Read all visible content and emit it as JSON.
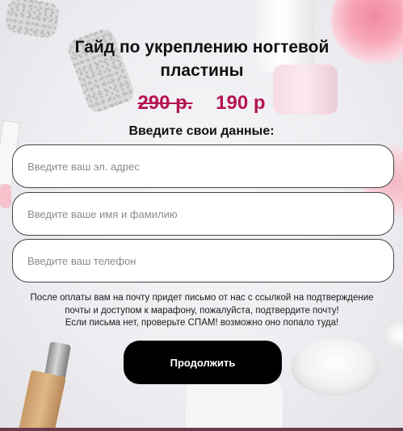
{
  "form": {
    "title_line1": "Гайд по укреплению ногтевой",
    "title_line2": "пластины",
    "old_price": "290 р.",
    "new_price": "190 р",
    "subtitle": "Введите свои данные:",
    "email_placeholder": "Введите ваш эл. адрес",
    "name_placeholder": "Введите ваше имя и фамилию",
    "phone_placeholder": "Введите ваш телефон",
    "note_line1": "После оплаты вам на почту придет письмо от нас с ссылкой на подтверждение",
    "note_line2": "почты и доступом к марафону, пожалуйста, подтвердите почту!",
    "note_line3": "Если письма нет, проверьте СПАМ! возможно оно попало туда!",
    "submit_label": "Продолжить"
  },
  "colors": {
    "accent_price": "#b5154f",
    "button_bg": "#000000",
    "button_text": "#ffffff"
  }
}
